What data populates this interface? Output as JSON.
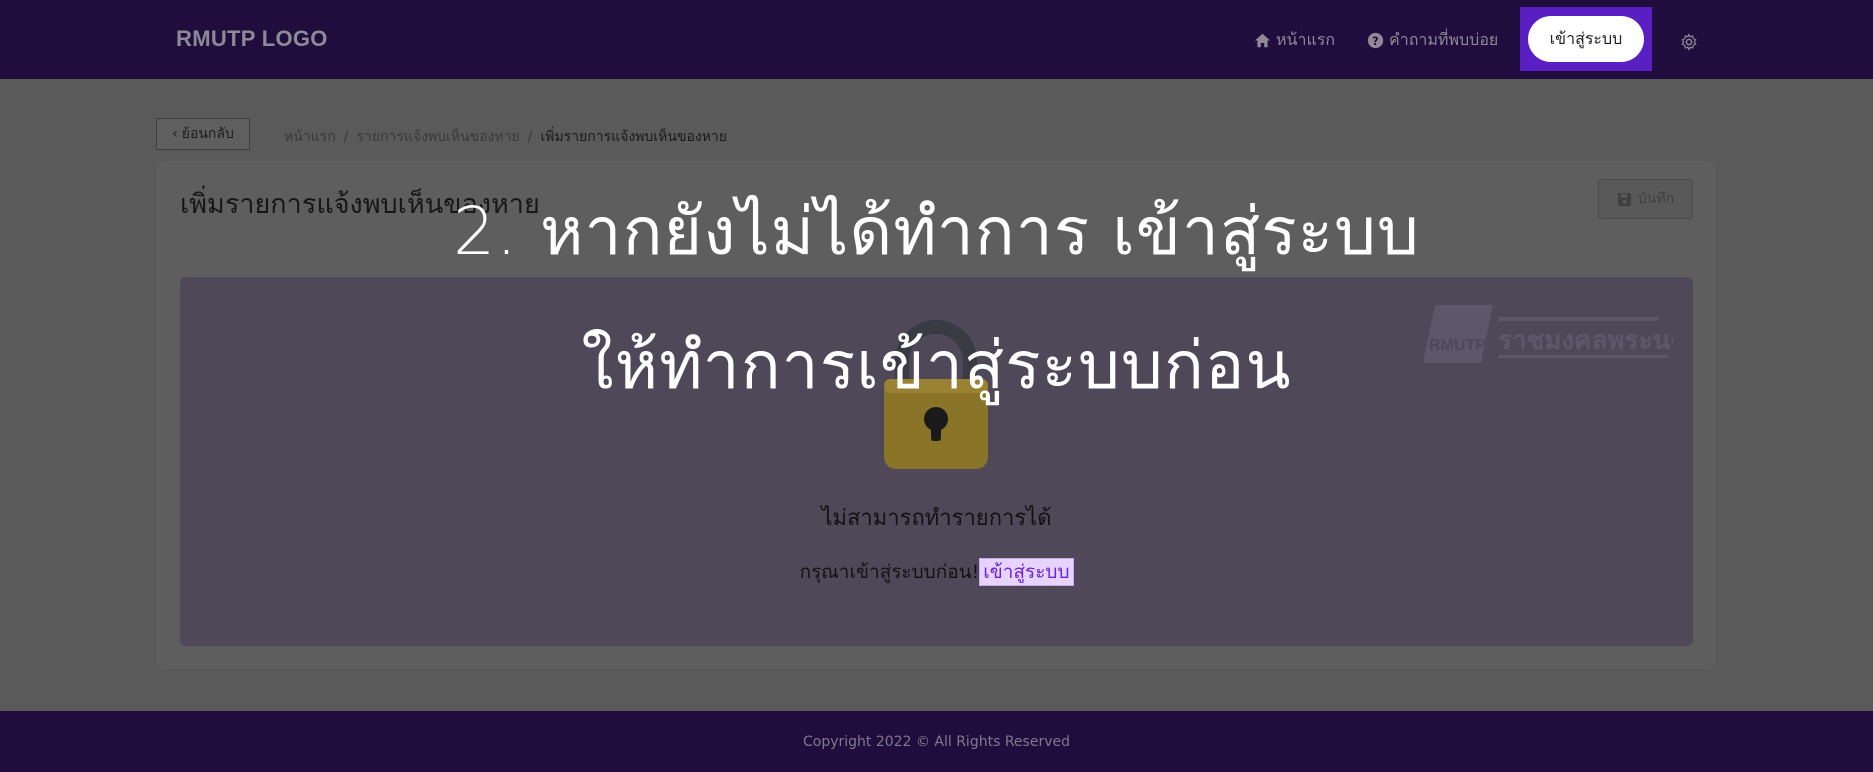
{
  "header": {
    "brand": "RMUTP LOGO",
    "nav": [
      {
        "label": "หน้าแรก",
        "icon": "home-icon"
      },
      {
        "label": "คำถามที่พบบ่อย",
        "icon": "question-circle-icon"
      }
    ],
    "login_label": "เข้าสู่ระบบ",
    "settings_icon": "gear-icon"
  },
  "page": {
    "back_label": "ย้อนกลับ",
    "breadcrumb": [
      "หน้าแรก",
      "รายการแจ้งพบเห็นของหาย",
      "เพิ่มรายการแจ้งพบเห็นของหาย"
    ],
    "title": "เพิ่มรายการแจ้งพบเห็นของหาย",
    "save_label": "บันทึก"
  },
  "panel": {
    "lock_icon": "lock-icon",
    "watermark_short": "RMUTP",
    "watermark_name": "ราชมงคลพระนคร",
    "message_title": "ไม่สามารถทำรายการได้",
    "message_text": "กรุณาเข้าสู่ระบบก่อน!",
    "message_link": "เข้าสู่ระบบ"
  },
  "overlay": {
    "line1": "2. หากยังไม่ได้ทำการ เข้าสู่ระบบ",
    "line2": "ให้ทำการเข้าสู่ระบบก่อน"
  },
  "footer": {
    "copyright": "Copyright 2022 © All Rights Reserved"
  },
  "colors": {
    "navbar": "#200c3d",
    "accent": "#5a1fc2",
    "link_bg": "#e7d3ff"
  }
}
